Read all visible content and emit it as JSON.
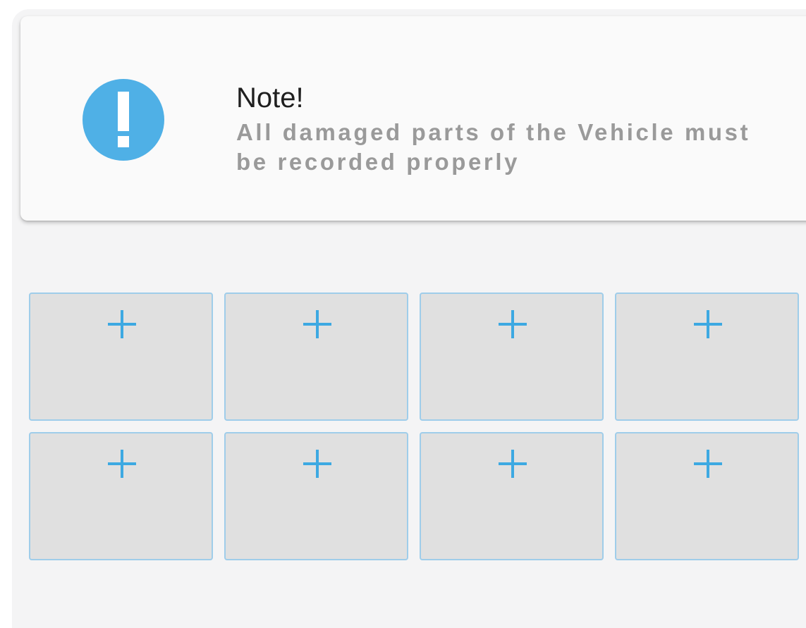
{
  "note": {
    "icon": "alert-circle-icon",
    "icon_color": "#4fb0e6",
    "title": "Note!",
    "text": "All damaged parts of the Vehicle must be recorded properly"
  },
  "photo_grid": {
    "slot_icon": "plus-icon",
    "accent_color": "#3da9e2",
    "slots": [
      {
        "icon": "plus-icon"
      },
      {
        "icon": "plus-icon"
      },
      {
        "icon": "plus-icon"
      },
      {
        "icon": "plus-icon"
      },
      {
        "icon": "plus-icon"
      },
      {
        "icon": "plus-icon"
      },
      {
        "icon": "plus-icon"
      },
      {
        "icon": "plus-icon"
      }
    ]
  }
}
